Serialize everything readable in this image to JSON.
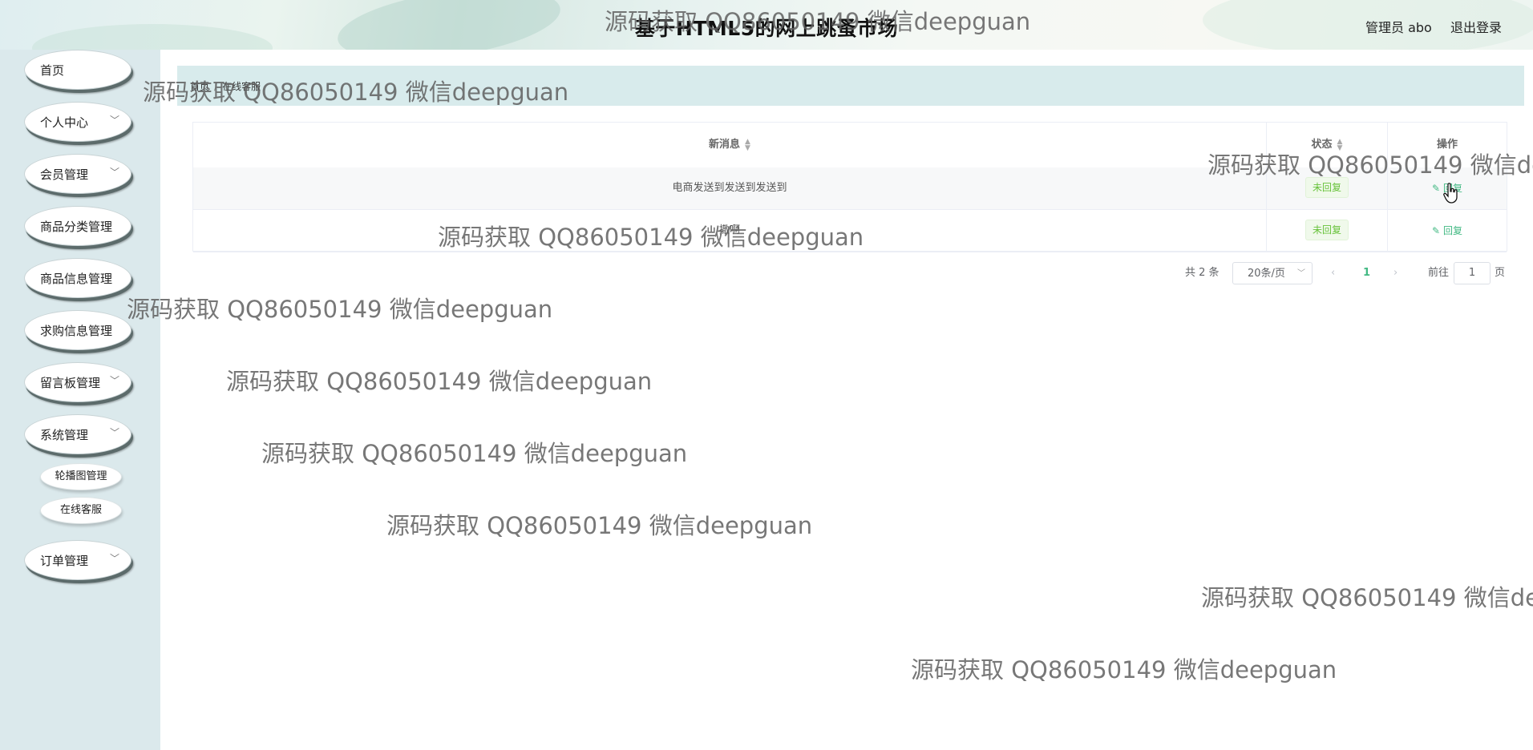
{
  "header": {
    "title": "基于HTML5的网上跳蚤市场",
    "user_label": "管理员 abo",
    "logout": "退出登录"
  },
  "sidebar": {
    "items": [
      {
        "label": "首页",
        "has_chevron": false
      },
      {
        "label": "个人中心",
        "has_chevron": true
      },
      {
        "label": "会员管理",
        "has_chevron": true
      },
      {
        "label": "商品分类管理",
        "has_chevron": false
      },
      {
        "label": "商品信息管理",
        "has_chevron": false
      },
      {
        "label": "求购信息管理",
        "has_chevron": false
      },
      {
        "label": "留言板管理",
        "has_chevron": true
      },
      {
        "label": "系统管理",
        "has_chevron": true
      },
      {
        "label": "订单管理",
        "has_chevron": true
      }
    ],
    "sub_items": [
      {
        "label": "轮播图管理"
      },
      {
        "label": "在线客服"
      }
    ],
    "chevron": "﹀"
  },
  "breadcrumb": {
    "home": "首页",
    "separator": "/",
    "current": "在线客服"
  },
  "table": {
    "columns": [
      "新消息",
      "状态",
      "操作"
    ],
    "sort_icon": "sort-icon",
    "rows": [
      {
        "message": "电商发送到发送到发送到",
        "status": "未回复",
        "action": "回复"
      },
      {
        "message": "撒啊",
        "status": "未回复",
        "action": "回复"
      }
    ]
  },
  "pagination": {
    "total": "共 2 条",
    "page_size": "20条/页",
    "prev": "‹",
    "current_page": "1",
    "next": "›",
    "goto_label": "前往",
    "goto_value": "1",
    "goto_unit": "页"
  },
  "watermark": {
    "text": "源码获取 QQ86050149 微信deepguan"
  },
  "colors": {
    "accent": "#42b983",
    "sidebar_bg": "#dbe9ec",
    "breadcrumb_bg": "#d8ebec",
    "tag_text": "#67c23a"
  }
}
